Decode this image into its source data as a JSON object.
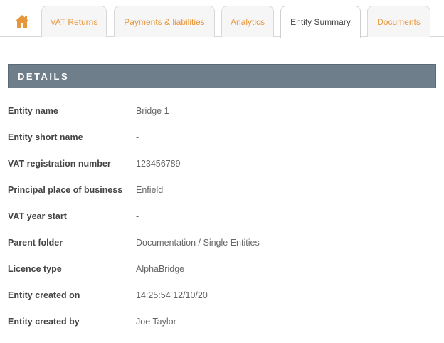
{
  "tabs": {
    "vat_returns": "VAT Returns",
    "payments": "Payments & liabilities",
    "analytics": "Analytics",
    "entity_summary": "Entity Summary",
    "documents": "Documents"
  },
  "section_title": "DETAILS",
  "details": [
    {
      "label": "Entity name",
      "value": "Bridge 1"
    },
    {
      "label": "Entity short name",
      "value": "-"
    },
    {
      "label": "VAT registration number",
      "value": "123456789"
    },
    {
      "label": "Principal place of business",
      "value": "Enfield"
    },
    {
      "label": "VAT year start",
      "value": "-"
    },
    {
      "label": "Parent folder",
      "value": "Documentation / Single Entities"
    },
    {
      "label": "Licence type",
      "value": "AlphaBridge"
    },
    {
      "label": "Entity created on",
      "value": "14:25:54 12/10/20"
    },
    {
      "label": "Entity created by",
      "value": "Joe Taylor"
    }
  ],
  "colors": {
    "accent": "#e8963a",
    "header_bar": "#6e7e8b"
  },
  "icons": {
    "home": "home-icon"
  }
}
